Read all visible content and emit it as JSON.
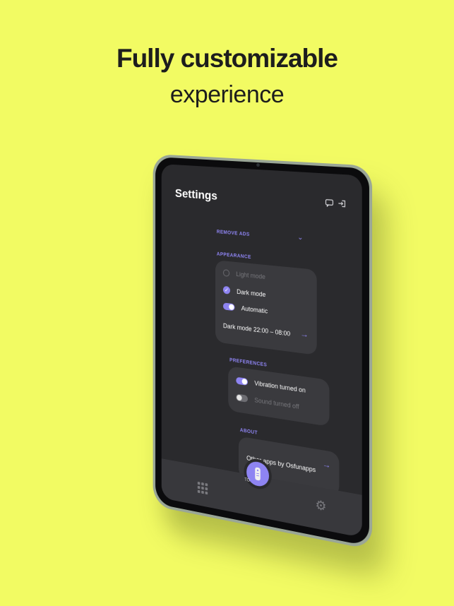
{
  "promo": {
    "headline": "Fully customizable",
    "subline": "experience"
  },
  "app": {
    "title": "Settings",
    "top_icons": [
      "chat-icon",
      "login-icon"
    ],
    "remove_ads": "REMOVE ADS",
    "appearance": {
      "header": "APPEARANCE",
      "light_mode": "Light mode",
      "dark_mode": "Dark mode",
      "automatic": "Automatic",
      "dark_mode_schedule": "Dark mode  22:00 – 08:00"
    },
    "preferences": {
      "header": "PREFERENCES",
      "vibration": "Vibration turned on",
      "sound": "Sound turned off"
    },
    "about": {
      "header": "ABOUT",
      "other_apps": "Other apps by Osfunapps"
    },
    "bottom_nav": {
      "fab_label": "TO",
      "left_icon": "grid-icon",
      "right_icon": "gear-icon"
    }
  },
  "colors": {
    "background": "#f2fb63",
    "accent": "#8e84f2",
    "screen": "#2a2a2d",
    "card": "#3a3a3e"
  }
}
